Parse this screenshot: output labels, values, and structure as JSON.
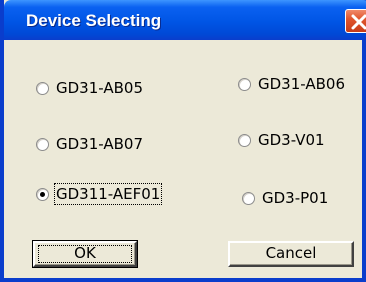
{
  "window": {
    "title": "Device Selecting"
  },
  "options": [
    {
      "label": "GD31-AB05",
      "checked": false
    },
    {
      "label": "GD31-AB06",
      "checked": false
    },
    {
      "label": "GD31-AB07",
      "checked": false
    },
    {
      "label": "GD3-V01",
      "checked": false
    },
    {
      "label": "GD311-AEF01",
      "checked": true
    },
    {
      "label": "GD3-P01",
      "checked": false
    }
  ],
  "buttons": {
    "ok_label": "OK",
    "cancel_label": "Cancel"
  },
  "colors": {
    "titlebar": "#0055e5",
    "dialog_bg": "#ece9d8",
    "close_button": "#e0562f"
  },
  "icons": {
    "close": "close-icon"
  }
}
